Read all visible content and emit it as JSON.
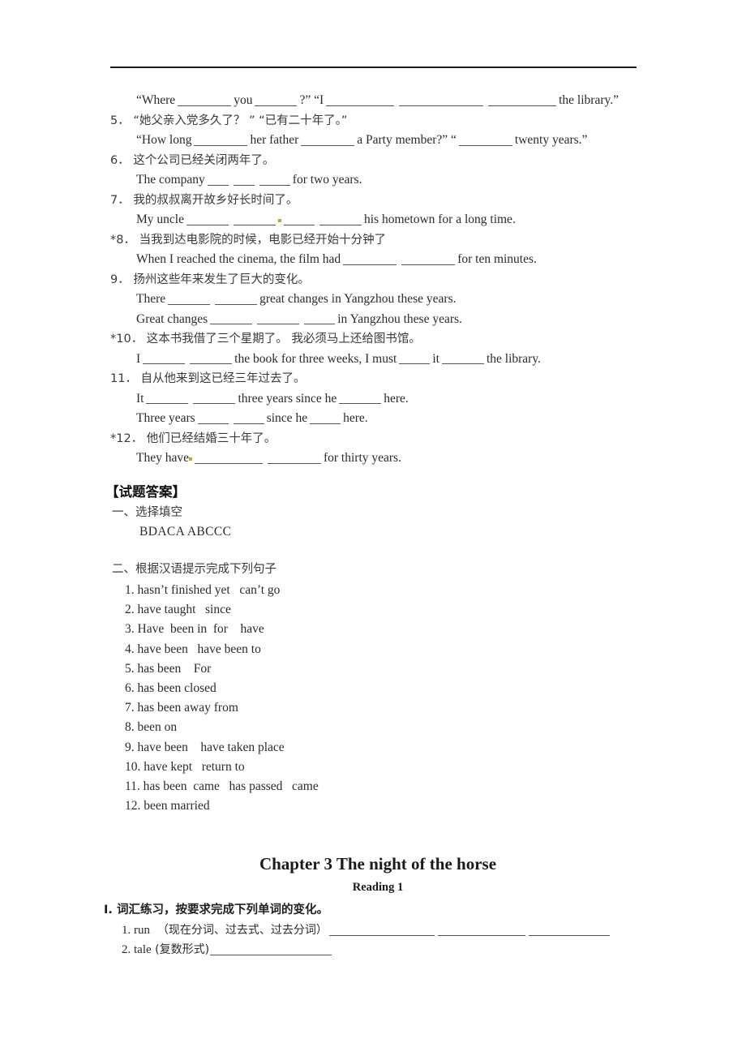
{
  "document": {
    "divider": "horizontal-rule"
  },
  "exercises": {
    "line_where": {
      "pre": "“Where",
      "mid1": "you",
      "mid2": "?”  “I",
      "tail": "the library.”"
    },
    "q5": {
      "cn": "5． “她父亲入党多久了？ ”   “已有二十年了。”",
      "en_pre": "“How long",
      "en_mid1": "her father",
      "en_mid2": "a Party member?”  “",
      "en_tail": "twenty years.”"
    },
    "q6": {
      "cn": "6． 这个公司已经关闭两年了。",
      "en_pre": "The company",
      "en_tail": "for two years."
    },
    "q7": {
      "cn": "7． 我的叔叔离开故乡好长时间了。",
      "en_pre": "My uncle",
      "en_tail": "his hometown for a long time."
    },
    "q8": {
      "cn": "*8． 当我到达电影院的时候，电影已经开始十分钟了",
      "en_pre": "When I reached the cinema, the film had",
      "en_tail": "for ten minutes."
    },
    "q9": {
      "cn": "9． 扬州这些年来发生了巨大的变化。",
      "en_a_pre": "There",
      "en_a_tail": "great changes in Yangzhou these years.",
      "en_b_pre": "Great changes",
      "en_b_tail": "in Yangzhou these years."
    },
    "q10": {
      "cn": "*10． 这本书我借了三个星期了。 我必须马上还给图书馆。",
      "en_pre": "I",
      "en_mid1": "the book for three weeks, I must",
      "en_mid2": "it",
      "en_tail": "the library."
    },
    "q11": {
      "cn": "11． 自从他来到这已经三年过去了。",
      "en_a_pre": "It",
      "en_a_mid": "three years since he",
      "en_a_tail": "here.",
      "en_b_pre": "Three years",
      "en_b_mid": "since he",
      "en_b_tail": "here."
    },
    "q12": {
      "cn": "*12． 他们已经结婚三十年了。",
      "en_pre": "They have",
      "en_tail": "for thirty years."
    }
  },
  "answers": {
    "heading": "【试题答案】",
    "section_one_label": "一、选择填空",
    "section_one_value": "BDACA  ABCCC",
    "section_two_label": "二、根据汉语提示完成下列句子",
    "items": [
      "1. hasn’t finished yet   can’t go",
      "2. have taught   since",
      "3. Have  been in  for    have",
      "4. have been   have been to",
      "5. has been    For",
      "6. has been closed",
      "7. has been away from",
      "8. been on",
      "9. have been    have taken place",
      "10. have kept   return to",
      "11. has been  came   has passed   came",
      "12. been married"
    ]
  },
  "chapter": {
    "title": "Chapter 3 The night of the horse",
    "subtitle": "Reading 1",
    "section_label": "I. 词汇练习，按要求完成下列单词的变化。",
    "item1_word": "1. run",
    "item1_hint": "（现在分词、过去式、过去分词）",
    "item2_word": "2. tale",
    "item2_hint": "(复数形式)"
  }
}
